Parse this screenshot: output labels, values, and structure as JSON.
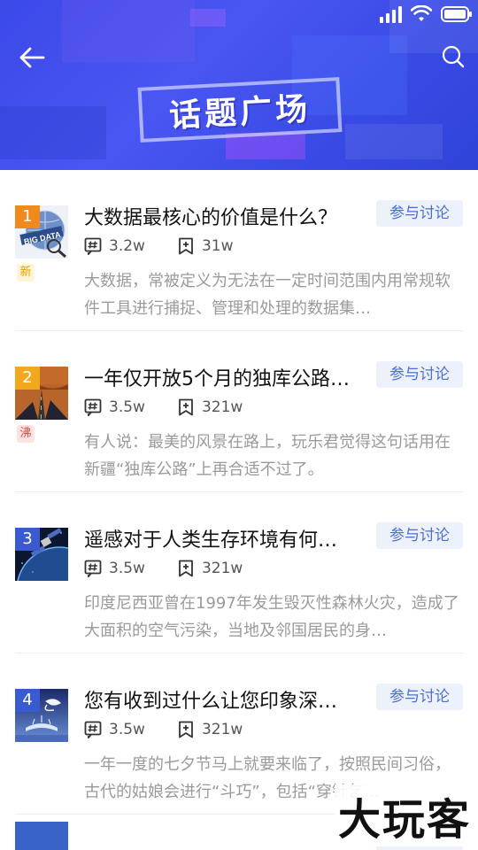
{
  "header": {
    "title": "话题广场",
    "back_icon": "arrow-left-icon",
    "search_icon": "search-icon"
  },
  "status_bar": {
    "icons": [
      "signal-icon",
      "wifi-icon",
      "battery-icon"
    ]
  },
  "topics": [
    {
      "rank": "1",
      "rank_color": "#f08a1c",
      "tag": "新",
      "tag_type": "new",
      "title": "大数据最核心的价值是什么？",
      "button": "参与讨论",
      "posts": "3.2w",
      "follows": "31w",
      "description": "大数据，常被定义为无法在一定时间范围内用常规软件工具进行捕捉、管理和处理的数据集…",
      "thumb": "big-data-image"
    },
    {
      "rank": "2",
      "rank_color": "#f2a81d",
      "tag": "沸",
      "tag_type": "hot",
      "title": "一年仅开放5个月的独库公路…",
      "button": "参与讨论",
      "posts": "3.5w",
      "follows": "321w",
      "description": "有人说：最美的风景在路上，玩乐君觉得这句话用在新疆“独库公路”上再合适不过了。",
      "thumb": "desert-road-image"
    },
    {
      "rank": "3",
      "rank_color": "#3a5bd0",
      "tag": "",
      "tag_type": "",
      "title": "遥感对于人类生存环境有何…",
      "button": "参与讨论",
      "posts": "3.5w",
      "follows": "321w",
      "description": "印度尼西亚曾在1997年发生毁灭性森林火灾，造成了大面积的空气污染，当地及邻国居民的身…",
      "thumb": "satellite-image"
    },
    {
      "rank": "4",
      "rank_color": "#3a5bd0",
      "tag": "",
      "tag_type": "",
      "title": "您有收到过什么让您印象深…",
      "button": "参与讨论",
      "posts": "3.5w",
      "follows": "321w",
      "description": "一年一度的七夕节马上就要来临了，按照民间习俗，古代的姑娘会进行“斗巧”，包括“穿针乞…",
      "thumb": "qixi-image"
    }
  ],
  "watermark": "大玩客"
}
